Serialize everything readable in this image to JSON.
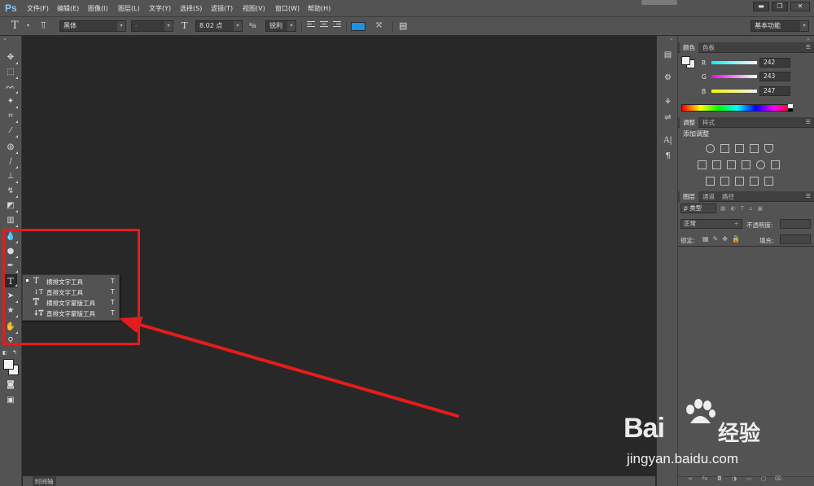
{
  "app": {
    "logo": "Ps"
  },
  "menu": [
    "文件(F)",
    "编辑(E)",
    "图像(I)",
    "图层(L)",
    "文字(Y)",
    "选择(S)",
    "滤镜(T)",
    "视图(V)",
    "窗口(W)",
    "帮助(H)"
  ],
  "window_controls": {
    "minimize": "▬",
    "restore": "❐",
    "close": "✕"
  },
  "options": {
    "tool_icon": "T",
    "font_family": "黑体",
    "font_style": "-",
    "font_size": "8.02 点",
    "aa_label": "ªa",
    "anti_alias": "锐利",
    "workspace": "基本功能",
    "text_color": "#1f8fe0"
  },
  "type_flyout": {
    "items": [
      {
        "label": "横排文字工具",
        "key": "T",
        "icon": "T",
        "selected": true
      },
      {
        "label": "直排文字工具",
        "key": "T",
        "icon": "↓T",
        "selected": false
      },
      {
        "label": "横排文字蒙版工具",
        "key": "T",
        "icon": "T",
        "selected": false
      },
      {
        "label": "直排文字蒙版工具",
        "key": "T",
        "icon": "↓T",
        "selected": false
      }
    ]
  },
  "color_panel": {
    "tabs": [
      "颜色",
      "色板"
    ],
    "channels": [
      {
        "name": "R",
        "value": "242"
      },
      {
        "name": "G",
        "value": "243"
      },
      {
        "name": "B",
        "value": "247"
      }
    ]
  },
  "adjust_panel": {
    "tabs": [
      "调整",
      "样式"
    ],
    "title": "添加调整"
  },
  "layers_panel": {
    "tabs": [
      "图层",
      "通道",
      "路径"
    ],
    "filter": "ρ 类型",
    "blend_mode": "正常",
    "opacity_label": "不透明度:",
    "lock_label": "锁定:",
    "fill_label": "填充:"
  },
  "timeline": {
    "label": "时间轴"
  },
  "watermark": {
    "brand": "Bai",
    "brand_cn": "经验",
    "url": "jingyan.baidu.com"
  },
  "annotation_color": "#e51c1c"
}
